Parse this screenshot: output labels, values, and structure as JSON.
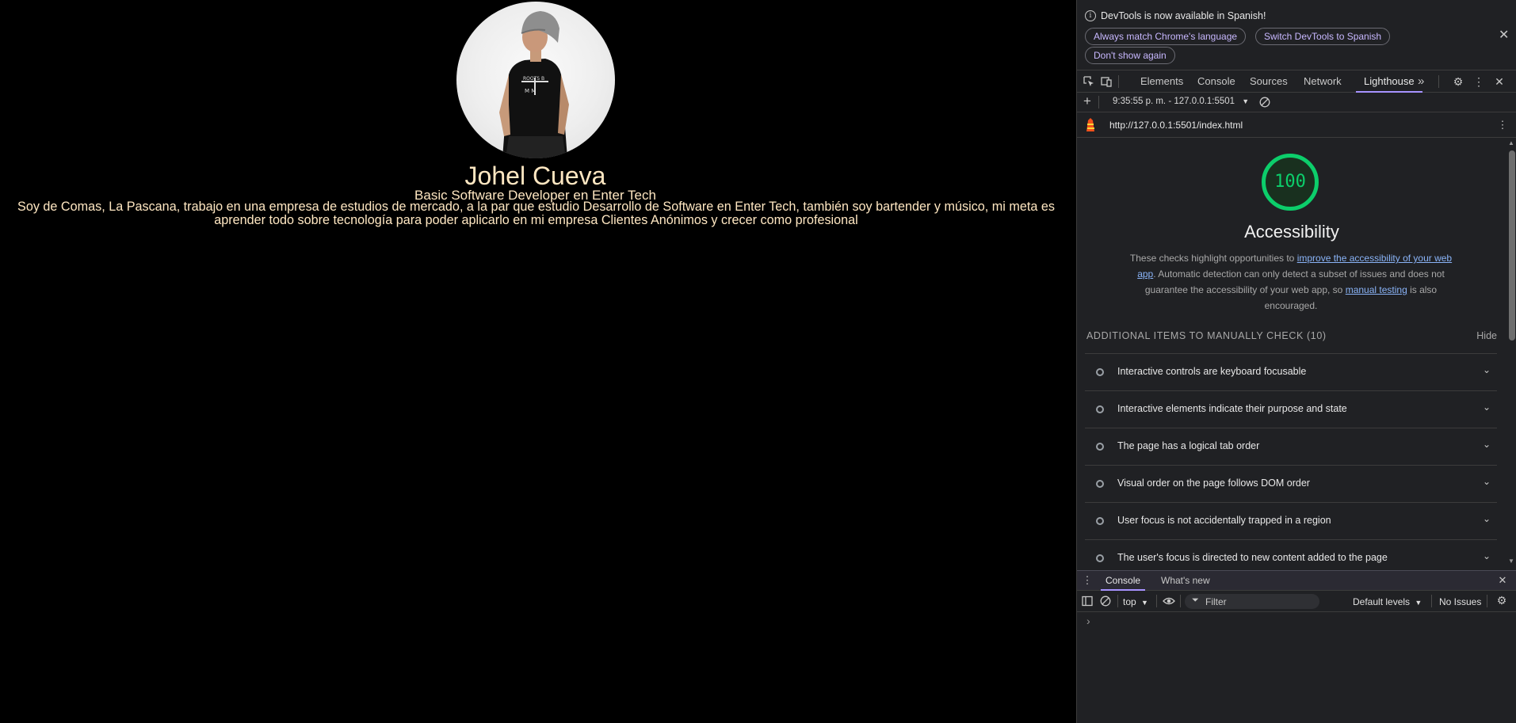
{
  "site": {
    "name": "Johel Cueva",
    "role": "Basic Software Developer en Enter Tech",
    "bio": "Soy de Comas, La Pascana, trabajo en una empresa de estudios de mercado, a la par que estudio Desarrollo de Software en Enter Tech, también soy bartender y músico, mi meta es aprender todo sobre tecnología para poder aplicarlo en mi empresa Clientes Anónimos y crecer como profesional",
    "text_color": "#ffe7c2",
    "background": "#000000"
  },
  "devtools": {
    "infobar": {
      "message": "DevTools is now available in Spanish!",
      "buttons": [
        "Always match Chrome's language",
        "Switch DevTools to Spanish",
        "Don't show again"
      ],
      "close": "✕"
    },
    "tabs": [
      "Elements",
      "Console",
      "Sources",
      "Network",
      "Lighthouse"
    ],
    "active_tab": "Lighthouse",
    "more_tabs": "»",
    "lighthouse": {
      "report_selector": "9:35:55 p. m. - 127.0.0.1:5501",
      "url": "http://127.0.0.1:5501/index.html",
      "score": "100",
      "score_color": "#0cce6b",
      "category_title": "Accessibility",
      "description": {
        "part1": "These checks highlight opportunities to ",
        "link1": "improve the accessibility of your web app",
        "part2": ". Automatic detection can only detect a subset of issues and does not guarantee the accessibility of your web app, so ",
        "link2": "manual testing",
        "part3": " is also encouraged."
      },
      "manual_header": "ADDITIONAL ITEMS TO MANUALLY CHECK (10)",
      "hide_label": "Hide",
      "audits": [
        "Interactive controls are keyboard focusable",
        "Interactive elements indicate their purpose and state",
        "The page has a logical tab order",
        "Visual order on the page follows DOM order",
        "User focus is not accidentally trapped in a region",
        "The user's focus is directed to new content added to the page"
      ]
    },
    "drawer": {
      "tabs": [
        "Console",
        "What's new"
      ],
      "active_tab": "Console",
      "context": "top",
      "filter_placeholder": "Filter",
      "levels": "Default levels",
      "issues": "No Issues",
      "prompt": "›"
    }
  }
}
